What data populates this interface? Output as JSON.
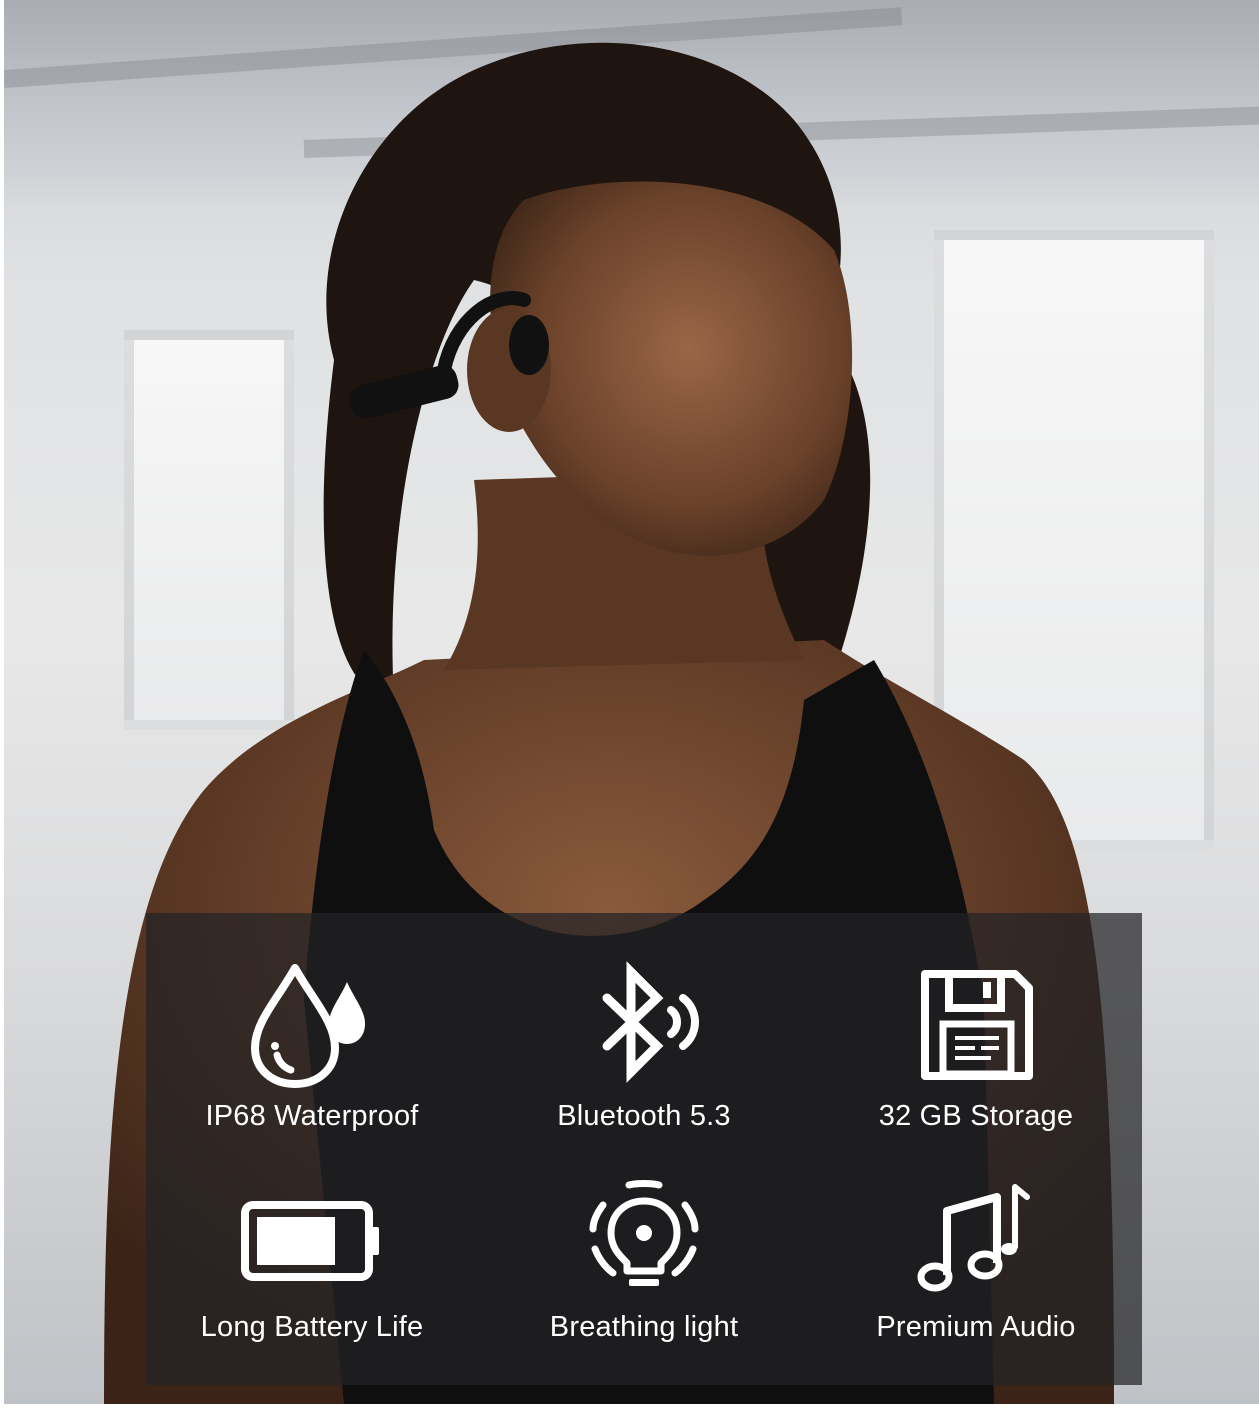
{
  "colors": {
    "panel": "#232325",
    "icon": "#ffffff",
    "label": "#ffffff"
  },
  "features": [
    {
      "icon": "water-drops-icon",
      "label": "IP68 Waterproof"
    },
    {
      "icon": "bluetooth-icon",
      "label": "Bluetooth 5.3"
    },
    {
      "icon": "floppy-disk-icon",
      "label": "32 GB Storage"
    },
    {
      "icon": "battery-icon",
      "label": "Long Battery Life"
    },
    {
      "icon": "breathing-light-icon",
      "label": "Breathing light"
    },
    {
      "icon": "music-notes-icon",
      "label": "Premium Audio"
    }
  ]
}
